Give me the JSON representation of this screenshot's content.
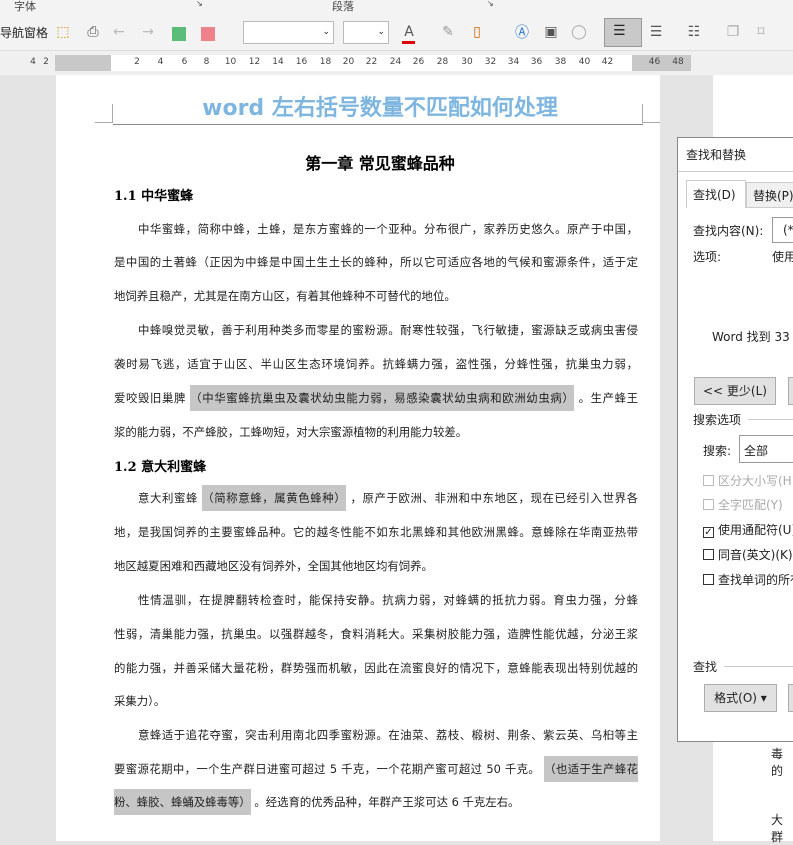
{
  "ribbon": {
    "group_font": "字体",
    "group_paragraph": "段落",
    "nav_pane": "导航窗格",
    "font_color": "#e00000"
  },
  "ruler": {
    "ticks": [
      "4",
      "2",
      "2",
      "4",
      "6",
      "8",
      "10",
      "12",
      "14",
      "16",
      "18",
      "20",
      "22",
      "24",
      "26",
      "28",
      "30",
      "32",
      "34",
      "36",
      "38",
      "40",
      "42",
      "46",
      "48"
    ]
  },
  "document": {
    "watermark": "word 左右括号数量不匹配如何处理",
    "chapter_title": "第一章 常见蜜蜂品种",
    "section1": "1.1  中华蜜蜂",
    "section2": "1.2  意大利蜜蜂",
    "highlight_color": "#c6c6c6",
    "lines": [
      {
        "segs": [
          {
            "t": "中华蜜蜂，简称中蜂，土蜂，是东方蜜蜂的一个亚种。分布很广，家养历史悠久。原产于中国，"
          }
        ]
      },
      {
        "segs": [
          {
            "t": "是中国的土著蜂（正因为中蜂是中国土生土长的蜂种，所以它可适应各地的气候和蜜源条件，适于定"
          }
        ]
      },
      {
        "segs": [
          {
            "t": "地饲养且稳产，尤其是在南方山区，有着其他蜂种不可替代的地位。"
          }
        ]
      },
      {
        "segs": [
          {
            "t": "中蜂嗅觉灵敏，善于利用种类多而零星的蜜粉源。耐寒性较强，飞行敏捷，蜜源缺乏或病虫害侵"
          }
        ]
      },
      {
        "segs": [
          {
            "t": "袭时易飞逃，适宜于山区、半山区生态环境饲养。抗蜂螨力强，盗性强，分蜂性强，抗巢虫力弱，"
          }
        ]
      },
      {
        "segs": [
          {
            "t": "爱咬毁旧巢脾"
          },
          {
            "t": "（中华蜜蜂抗巢虫及囊状幼虫能力弱，易感染囊状幼虫病和欧洲幼虫病）",
            "hl": true
          },
          {
            "t": "。生产蜂王"
          }
        ]
      },
      {
        "segs": [
          {
            "t": "浆的能力弱，不产蜂胶，工蜂吻短，对大宗蜜源植物的利用能力较差。"
          }
        ]
      },
      {
        "segs": [
          {
            "t": "意大利蜜蜂"
          },
          {
            "t": "（简称意蜂，属黄色蜂种）",
            "hl": true
          },
          {
            "t": "，原产于欧洲、非洲和中东地区，现在已经引入世界各"
          }
        ]
      },
      {
        "segs": [
          {
            "t": "地，是我国饲养的主要蜜蜂品种。它的越冬性能不如东北黑蜂和其他欧洲黑蜂。意蜂除在华南亚热带"
          }
        ]
      },
      {
        "segs": [
          {
            "t": "地区越夏困难和西藏地区没有饲养外，全国其他地区均有饲养。"
          }
        ]
      },
      {
        "segs": [
          {
            "t": "性情温驯，在提脾翻转检查时，能保持安静。抗病力弱，对蜂螨的抵抗力弱。育虫力强，分蜂"
          }
        ]
      },
      {
        "segs": [
          {
            "t": "性弱，清巢能力强，抗巢虫。以强群越冬，食料消耗大。采集树胶能力强，造脾性能优越，分泌王浆"
          }
        ]
      },
      {
        "segs": [
          {
            "t": "的能力强，并善采储大量花粉，群势强而机敏，因此在流蜜良好的情况下，意蜂能表现出特别优越的"
          }
        ]
      },
      {
        "segs": [
          {
            "t": "采集力）。"
          }
        ]
      },
      {
        "segs": [
          {
            "t": "意蜂适于追花夺蜜，突击利用南北四季蜜粉源。在油菜、荔枝、椴树、荆条、紫云英、乌桕等主"
          }
        ]
      },
      {
        "segs": [
          {
            "t": "要蜜源花期中，一个生产群日进蜜可超过 5 千克，一个花期产蜜可超过 50 千克。"
          },
          {
            "t": "（也适于生产蜂花",
            "hl": true
          }
        ]
      },
      {
        "segs": [
          {
            "t": "粉、蜂胶、蜂蛹及蜂毒等）",
            "hl": true
          },
          {
            "t": "。经选育的优秀品种，年群产王浆可达 6 千克左右。"
          }
        ]
      }
    ],
    "page2_text1": "毒的",
    "page2_text2": "大群"
  },
  "dialog": {
    "title": "查找和替换",
    "tab_find": "查找(D)",
    "tab_replace": "替换(P)",
    "find_label": "查找内容(N):",
    "find_value": "(*)",
    "options_label": "选项:",
    "options_value": "使用通配符",
    "result": "Word 找到 33",
    "less_button": "<< 更少(L)",
    "search_options": "搜索选项",
    "search_label": "搜索:",
    "search_value": "全部",
    "opt_case": "区分大小写(H)",
    "opt_whole": "全字匹配(Y)",
    "opt_wildcard": "使用通配符(U)",
    "opt_sounds": "同音(英文)(K)",
    "opt_forms": "查找单词的所有形式",
    "find_section": "查找",
    "format_button": "格式(O) ▾"
  }
}
